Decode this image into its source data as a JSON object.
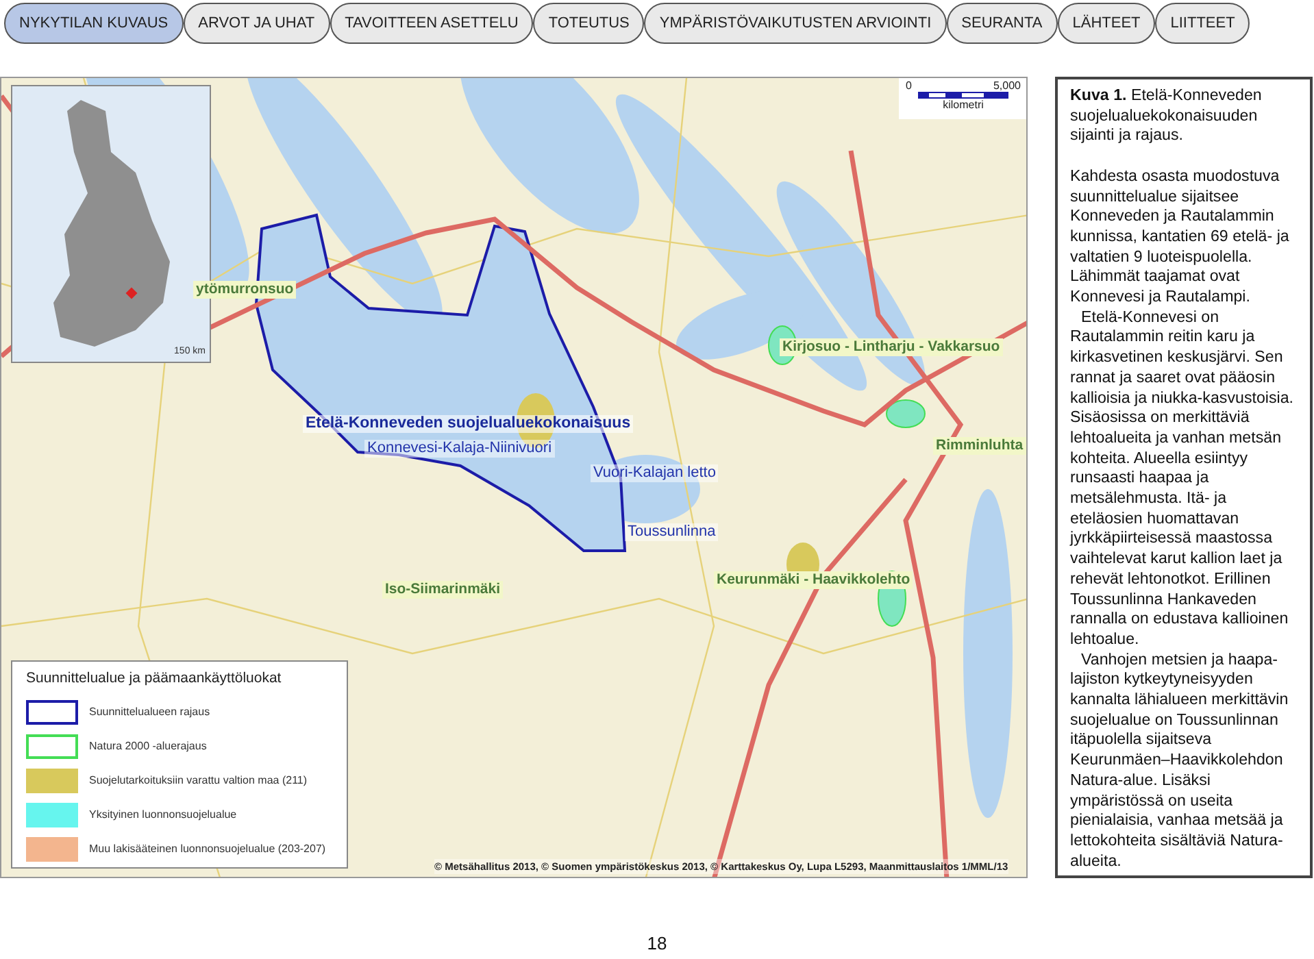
{
  "tabs": [
    {
      "label": "NYKYTILAN KUVAUS",
      "selected": true
    },
    {
      "label": "ARVOT JA UHAT",
      "selected": false
    },
    {
      "label": "TAVOITTEEN ASETTELU",
      "selected": false
    },
    {
      "label": "TOTEUTUS",
      "selected": false
    },
    {
      "label": "YMPÄRISTÖVAIKUTUSTEN ARVIOINTI",
      "selected": false
    },
    {
      "label": "SEURANTA",
      "selected": false
    },
    {
      "label": "LÄHTEET",
      "selected": false
    },
    {
      "label": "LIITTEET",
      "selected": false
    }
  ],
  "map": {
    "inset": {
      "scale_label": "150 km"
    },
    "scale_bar": {
      "ticks": [
        "0",
        "5,000"
      ],
      "unit": "kilometri"
    },
    "labels": [
      {
        "text": "ytömurronsuo",
        "kind": "site"
      },
      {
        "text": "Etelä-Konneveden suojelualuekokonaisuus",
        "kind": "main"
      },
      {
        "text": "Konnevesi-Kalaja-Niinivuori",
        "kind": "area"
      },
      {
        "text": "Vuori-Kalajan letto",
        "kind": "area"
      },
      {
        "text": "Toussunlinna",
        "kind": "area"
      },
      {
        "text": "Iso-Siimarinmäki",
        "kind": "site"
      },
      {
        "text": "Kirjosuo - Lintharju - Vakkarsuo",
        "kind": "site"
      },
      {
        "text": "Rimminluhta",
        "kind": "site"
      },
      {
        "text": "Keurunmäki - Haavikkolehto",
        "kind": "site"
      }
    ],
    "legend": {
      "title": "Suunnittelualue ja päämaankäyttöluokat",
      "items": [
        {
          "label": "Suunnittelualueen rajaus",
          "kind": "outline",
          "color": "#1c1ca8"
        },
        {
          "label": "Natura 2000 -aluerajaus",
          "kind": "outline",
          "color": "#44dd55"
        },
        {
          "label": "Suojelutarkoituksiin varattu valtion maa (211)",
          "kind": "fill",
          "color": "#d8c95c"
        },
        {
          "label": "Yksityinen luonnonsuojelualue",
          "kind": "fill",
          "color": "#66f5ee"
        },
        {
          "label": "Muu lakisääteinen luonnonsuojelualue (203-207)",
          "kind": "fill",
          "color": "#f3b58e"
        }
      ]
    },
    "copyright": "© Metsähallitus 2013, © Suomen ympäristökeskus 2013, © Karttakeskus Oy, Lupa L5293, Maanmittauslaitos 1/MML/13"
  },
  "caption": "**Kuva 1.** Etelä-Konneveden suojelualuekokonaisuuden sijainti ja rajaus.",
  "paragraphs": [
    {
      "text": "Kahdesta osasta muodostuva suunnittelualue sijaitsee Konneveden ja Rautalammin kunnissa, kantatien 69 etelä- ja valtatien 9 luoteispuolella. Lähimmät taajamat ovat Konnevesi ja Rautalampi.",
      "indented": false
    },
    {
      "text": "Etelä-Konnevesi on Rautalammin reitin karu ja kirkasvetinen keskusjärvi. Sen rannat ja saaret ovat pääosin kallioisia ja niukka-kasvustoisia. Sisäosissa on merkittäviä lehtoalueita ja vanhan metsän kohteita. Alueella esiintyy runsaasti haapaa ja metsälehmusta. Itä- ja eteläosien huomattavan jyrkkäpiirteisessä maastossa vaihtelevat karut kallion laet ja rehevät lehtonotkot. Erillinen Toussunlinna Hankaveden rannalla on edustava kallioinen lehtoalue.",
      "indented": true
    },
    {
      "text": "Vanhojen metsien ja haapa-lajiston kytkeytyneisyyden kannalta lähialueen merkittävin suojelualue on Toussunlinnan itäpuolella sijaitseva Keurunmäen–Haavikkolehdon Natura-alue. Lisäksi ympäristössä on useita pienialaisia, vanhaa metsää ja lettokohteita sisältäviä Natura-alueita.",
      "indented": true
    }
  ],
  "page_number": "18"
}
